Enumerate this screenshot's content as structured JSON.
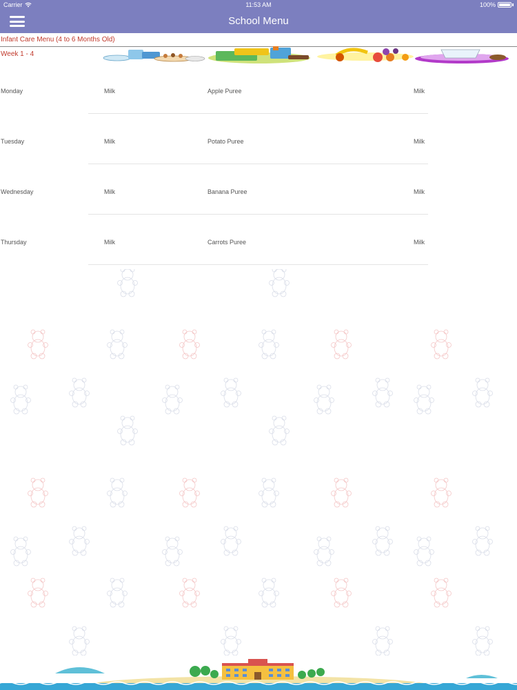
{
  "status": {
    "carrier": "Carrier",
    "time": "11:53 AM",
    "battery": "100%"
  },
  "nav": {
    "title": "School Menu"
  },
  "menu": {
    "heading": "Infant Care Menu (4 to 6 Months Old)",
    "week": "Week 1 - 4",
    "rows": [
      {
        "day": "Monday",
        "c1": "Milk",
        "c2": "Apple Puree",
        "c3": "Milk"
      },
      {
        "day": "Tuesday",
        "c1": "Milk",
        "c2": "Potato Puree",
        "c3": "Milk"
      },
      {
        "day": "Wednesday",
        "c1": "Milk",
        "c2": "Banana Puree",
        "c3": "Milk"
      },
      {
        "day": "Thursday",
        "c1": "Milk",
        "c2": "Carrots Puree",
        "c3": "Milk"
      }
    ]
  },
  "icons": {
    "menu": "hamburger-menu-icon",
    "wifi": "wifi-icon",
    "battery": "battery-icon"
  },
  "colors": {
    "nav_bg": "#7c7fbf",
    "heading": "#c0392b",
    "cell_text": "#555555"
  }
}
